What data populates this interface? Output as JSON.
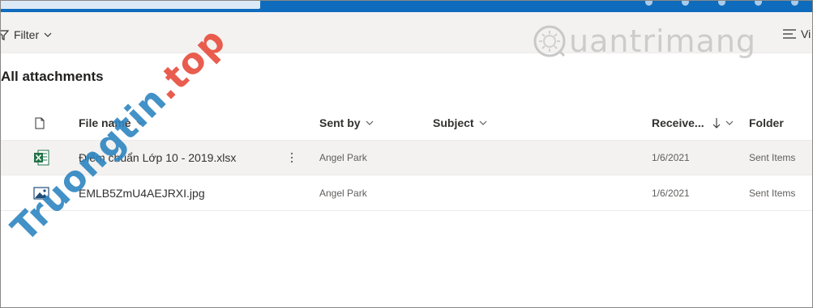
{
  "cmdbar": {
    "filter_label": "Filter",
    "view_label": "Vi"
  },
  "page": {
    "title": "All attachments"
  },
  "table": {
    "headers": {
      "file_name": "File name",
      "sent_by": "Sent by",
      "subject": "Subject",
      "received": "Receive...",
      "folder": "Folder"
    },
    "rows": [
      {
        "icon": "excel-file-icon",
        "file_name": "Điểm chuẩn Lớp 10 - 2019.xlsx",
        "sent_by": "Angel Park",
        "subject": "",
        "received": "1/6/2021",
        "folder": "Sent Items"
      },
      {
        "icon": "image-file-icon",
        "file_name": "EMLB5ZmU4AEJRXI.jpg",
        "sent_by": "Angel Park",
        "subject": "",
        "received": "1/6/2021",
        "folder": "Sent Items"
      }
    ]
  },
  "watermarks": {
    "left_main": "Truongtin",
    "left_accent": ".top",
    "right": "uantrimang"
  },
  "colors": {
    "header_blue": "#0f6cbd",
    "excel_green": "#217346",
    "wm_blue": "#2e86c1",
    "wm_red": "#e74c3c"
  }
}
